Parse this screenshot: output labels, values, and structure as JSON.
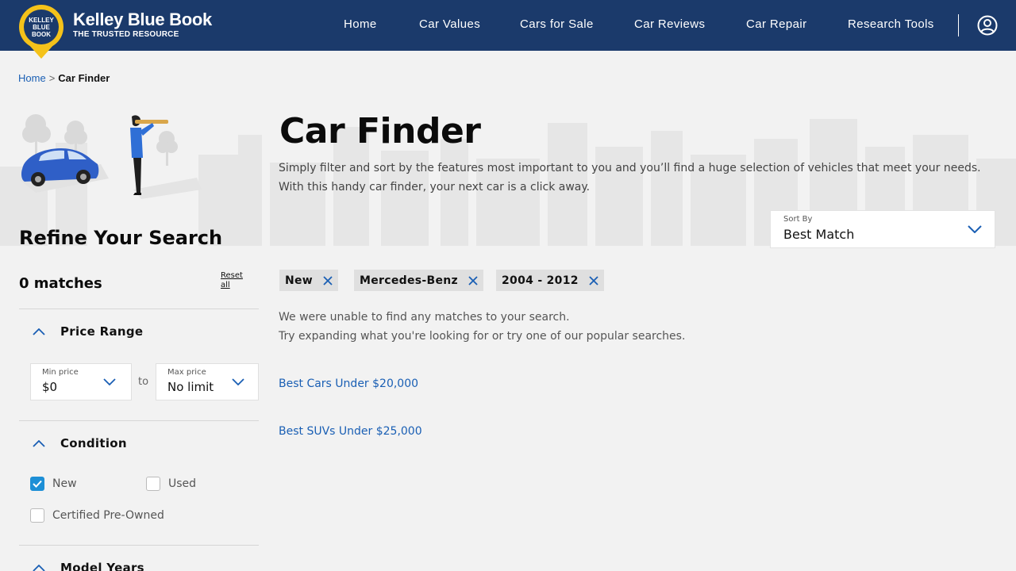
{
  "header": {
    "logo": {
      "badge_text": "KELLEY BLUE BOOK",
      "icon": "kbb-badge-logo"
    },
    "brand_name": "Kelley Blue Book",
    "tagline": "THE TRUSTED RESOURCE",
    "nav": [
      "Home",
      "Car Values",
      "Cars for Sale",
      "Car Reviews",
      "Car Repair",
      "Research Tools"
    ],
    "account_icon": "user-account-icon",
    "colors": {
      "bar": "#1b3a6b",
      "badge": "#f4c21a"
    }
  },
  "breadcrumb": {
    "home": "Home",
    "separator": ">",
    "current": "Car Finder"
  },
  "page": {
    "title": "Car Finder",
    "description": "Simply filter and sort by the features most important to you and you’ll find a huge selection of vehicles that meet your needs. With this handy car finder, your next car is a click away."
  },
  "sort": {
    "label": "Sort By",
    "value": "Best Match",
    "icon": "chevron-down-icon"
  },
  "filters": {
    "title": "Refine Your Search",
    "matches": "0 matches",
    "reset": "Reset all",
    "price": {
      "title": "Price Range",
      "min_label": "Min price",
      "min_value": "$0",
      "to": "to",
      "max_label": "Max price",
      "max_value": "No limit"
    },
    "condition": {
      "title": "Condition",
      "options": [
        {
          "label": "New",
          "checked": true
        },
        {
          "label": "Used",
          "checked": false
        },
        {
          "label": "Certified Pre-Owned",
          "checked": false
        }
      ]
    },
    "model_years": {
      "title": "Model Years"
    }
  },
  "active_chips": [
    "New",
    "Mercedes-Benz",
    "2004 - 2012"
  ],
  "results": {
    "no_match": "We were unable to find any matches to your search.",
    "suggestion": "Try expanding what you're looking for or try one of our popular searches.",
    "popular_searches": [
      "Best Cars Under $20,000",
      "Best SUVs Under $25,000"
    ]
  },
  "colors": {
    "accent": "#1a5fb4",
    "checkbox": "#1d8fd6",
    "chip": "#dfdfdf"
  }
}
